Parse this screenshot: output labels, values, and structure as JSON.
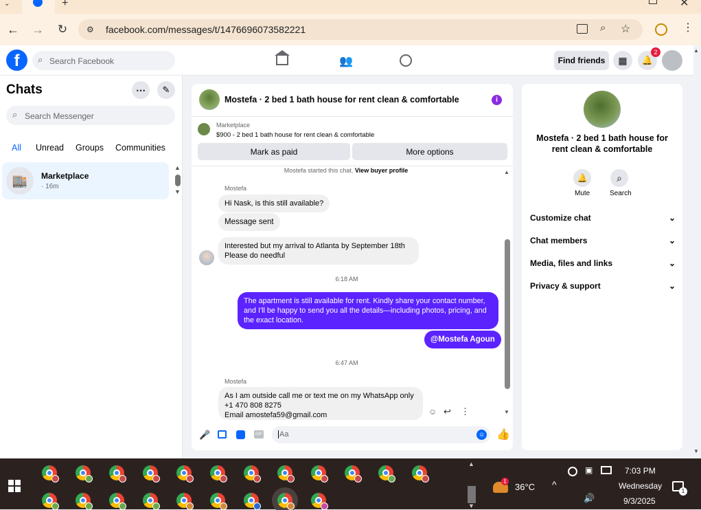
{
  "browser": {
    "url": "facebook.com/messages/t/1476696073582221"
  },
  "header": {
    "search_placeholder": "Search Facebook",
    "find_friends": "Find friends",
    "notification_count": "2"
  },
  "sidebar": {
    "title": "Chats",
    "search_placeholder": "Search Messenger",
    "filters": [
      "All",
      "Unread",
      "Groups",
      "Communities"
    ],
    "active_filter": "All",
    "conversation": {
      "name": "Marketplace",
      "time": "· 16m"
    }
  },
  "chat": {
    "title": "Mostefa · 2 bed 1 bath house for rent clean & comfortable",
    "marketplace_label": "Marketplace",
    "listing": "$900 - 2 bed 1 bath house for rent clean & comfortable",
    "mark_paid": "Mark as paid",
    "more_options": "More options",
    "started_text": "Mostefa started this chat.",
    "view_profile": "View buyer profile",
    "sender_name": "Mostefa",
    "messages": [
      "Hi Nask, is this still available?",
      "Message sent",
      "Interested but my arrival to Atlanta by September 18th\nPlease do needful",
      "The apartment is still available for rent. Kindly share your contact number, and I'll be happy to send you all the details—including photos, pricing, and the exact location.",
      "@Mostefa Agoun",
      "As I am outside call me or text me on my WhatsApp only\n+1 470 808 8275\nEmail amostefa59@gmail.com"
    ],
    "time1": "6:18 AM",
    "time2": "6:47 AM",
    "composer_placeholder": "Aa"
  },
  "info_panel": {
    "title": "Mostefa · 2 bed 1 bath house for rent clean & comfortable",
    "mute": "Mute",
    "search": "Search",
    "sections": [
      "Customize chat",
      "Chat members",
      "Media, files and links",
      "Privacy & support"
    ]
  },
  "taskbar": {
    "temperature": "36°C",
    "time": "7:03 PM",
    "day": "Wednesday",
    "date": "9/3/2025",
    "weather_badge": "1",
    "notif_badge": "1"
  },
  "colors": {
    "fb_blue": "#0866ff",
    "my_bubble": "#5b23ff",
    "accent_purple": "#8a2be2"
  }
}
